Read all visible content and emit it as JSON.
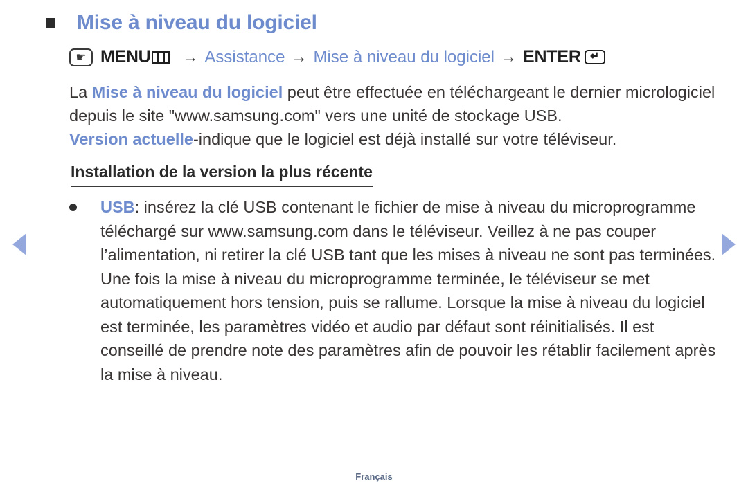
{
  "page": {
    "title": "Mise à niveau du logiciel",
    "title_bullet_icon": "square-bullet-icon",
    "footer_label": "Français"
  },
  "menu_path": {
    "oo_icon": "hand-press-icon",
    "menu_label": "MENU",
    "menu_box_icon": "menu-grid-icon",
    "arrow_1": "→",
    "step_1": "Assistance",
    "arrow_2": "→",
    "step_2": "Mise à niveau du logiciel",
    "arrow_3": "→",
    "enter_label": "ENTER",
    "enter_icon": "enter-return-icon"
  },
  "body": {
    "line1_pre": "La ",
    "line1_highlight": "Mise à niveau du logiciel",
    "line1_post": " peut être effectuée en téléchargeant le dernier micrologiciel depuis le site \"www.samsung.com\" vers une unité de stockage USB.",
    "line2_highlight": "Version actuelle",
    "line2_post": "-indique que le logiciel est déjà installé sur votre téléviseur."
  },
  "subheading": "Installation de la version la plus récente",
  "bullet": {
    "dot_icon": "round-bullet-icon",
    "label": "USB",
    "text": ": insérez la clé USB contenant le fichier de mise à niveau du microprogramme téléchargé sur www.samsung.com dans le téléviseur. Veillez à ne pas couper l’alimentation, ni retirer la clé USB tant que les mises à niveau ne sont pas terminées. Une fois la mise à niveau du microprogramme terminée, le téléviseur se met automatiquement hors tension, puis se rallume. Lorsque la mise à niveau du logiciel est terminée, les paramètres vidéo et audio par défaut sont réinitialisés. Il est conseillé de prendre note des paramètres afin de pouvoir les rétablir facilement après la mise à niveau."
  },
  "navigation": {
    "prev_arrow": "prev-page-arrow",
    "next_arrow": "next-page-arrow"
  },
  "colors": {
    "accent_blue": "#6e8ccd",
    "arrow_blue": "#94a8dd",
    "body_text": "#3a3535"
  }
}
